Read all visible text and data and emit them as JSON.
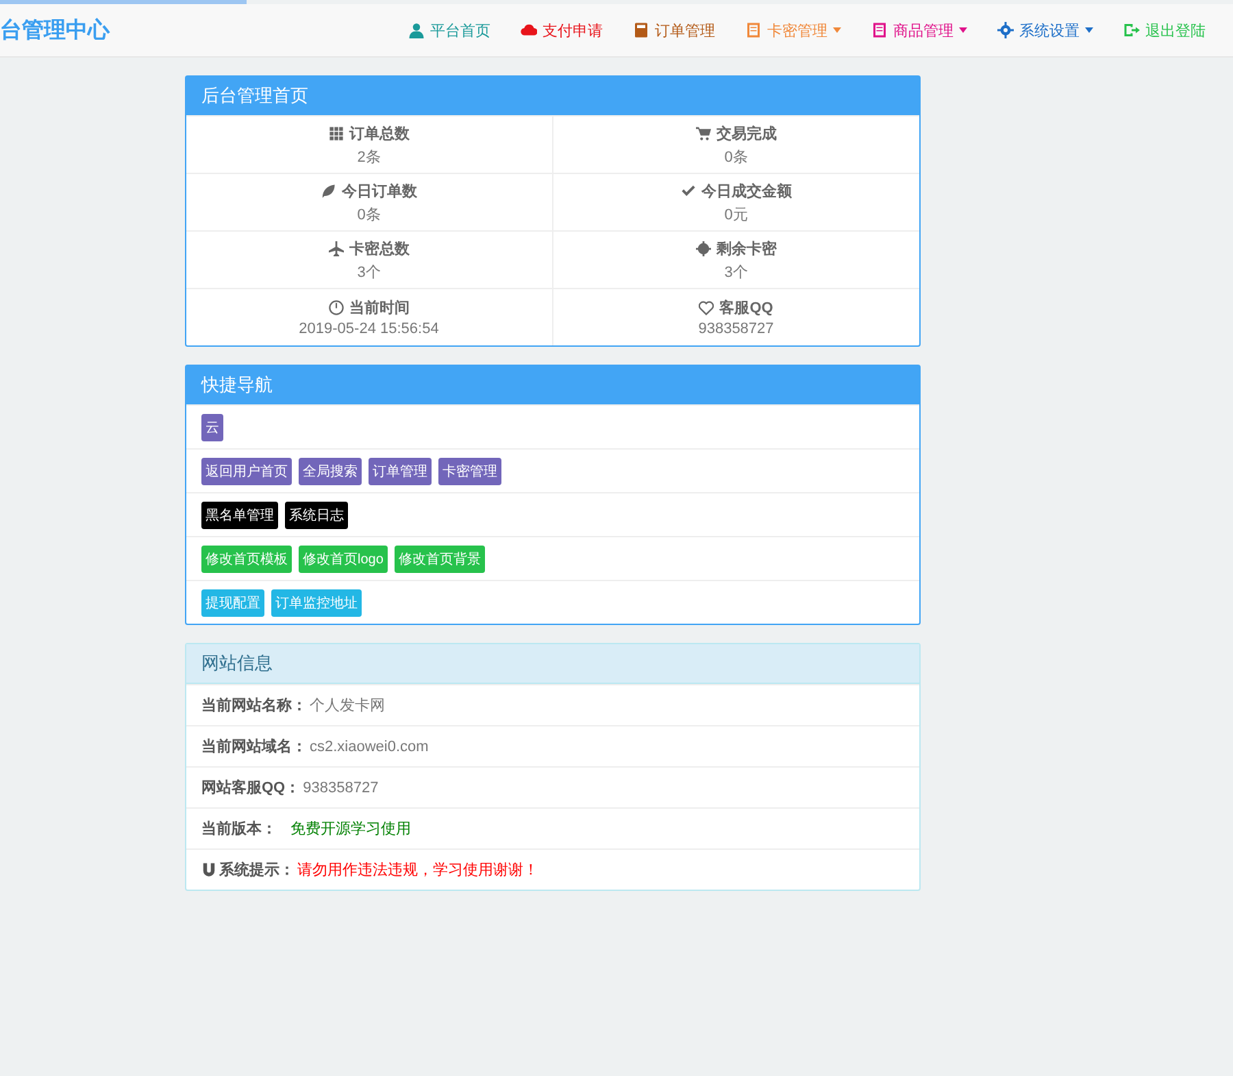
{
  "loading_bar": {
    "level": 0.2
  },
  "navbar": {
    "brand": "台管理中心",
    "items": [
      {
        "label": "平台首页",
        "color": "#1b9a9a",
        "dropdown": false
      },
      {
        "label": "支付申请",
        "color": "#e8141b",
        "dropdown": false
      },
      {
        "label": "订单管理",
        "color": "#b35a17",
        "dropdown": false
      },
      {
        "label": "卡密管理",
        "color": "#f0883a",
        "dropdown": true
      },
      {
        "label": "商品管理",
        "color": "#e0128a",
        "dropdown": true
      },
      {
        "label": "系统设置",
        "color": "#1e6fc8",
        "dropdown": true
      },
      {
        "label": "退出登陆",
        "color": "#27c24c",
        "dropdown": false
      }
    ]
  },
  "overview": {
    "title": "后台管理首页",
    "stats": [
      {
        "label": "订单总数",
        "value": "2条"
      },
      {
        "label": "交易完成",
        "value": "0条"
      },
      {
        "label": "今日订单数",
        "value": "0条"
      },
      {
        "label": "今日成交金额",
        "value": "0元"
      },
      {
        "label": "卡密总数",
        "value": "3个"
      },
      {
        "label": "剩余卡密",
        "value": "3个"
      },
      {
        "label": "当前时间",
        "value": "2019-05-24 15:56:54"
      },
      {
        "label": "客服QQ",
        "value": "938358727"
      }
    ]
  },
  "quick_nav": {
    "title": "快捷导航",
    "rows": [
      [
        {
          "label": "云",
          "color": "#7266ba"
        }
      ],
      [
        {
          "label": "返回用户首页",
          "color": "#7266ba"
        },
        {
          "label": "全局搜索",
          "color": "#7266ba"
        },
        {
          "label": "订单管理",
          "color": "#7266ba"
        },
        {
          "label": "卡密管理",
          "color": "#7266ba"
        }
      ],
      [
        {
          "label": "黑名单管理",
          "color": "#000000"
        },
        {
          "label": "系统日志",
          "color": "#000000"
        }
      ],
      [
        {
          "label": "修改首页模板",
          "color": "#27c24c"
        },
        {
          "label": "修改首页logo",
          "color": "#27c24c"
        },
        {
          "label": "修改首页背景",
          "color": "#27c24c"
        }
      ],
      [
        {
          "label": "提现配置",
          "color": "#23b7e5"
        },
        {
          "label": "订单监控地址",
          "color": "#23b7e5"
        }
      ]
    ]
  },
  "site_info": {
    "title": "网站信息",
    "rows": [
      {
        "label": "当前网站名称：",
        "value": "个人发卡网",
        "color": "#777777",
        "icon": false
      },
      {
        "label": "当前网站域名：",
        "value": "cs2.xiaowei0.com",
        "color": "#777777",
        "icon": false
      },
      {
        "label": "网站客服QQ：",
        "value": "938358727",
        "color": "#777777",
        "icon": false
      },
      {
        "label": "当前版本：",
        "value": "免费开源学习使用",
        "color": "#008000",
        "icon": false
      },
      {
        "label": "系统提示：",
        "value": "请勿用作违法违规，学习使用谢谢！",
        "color": "#ff0000",
        "icon": true
      }
    ]
  }
}
